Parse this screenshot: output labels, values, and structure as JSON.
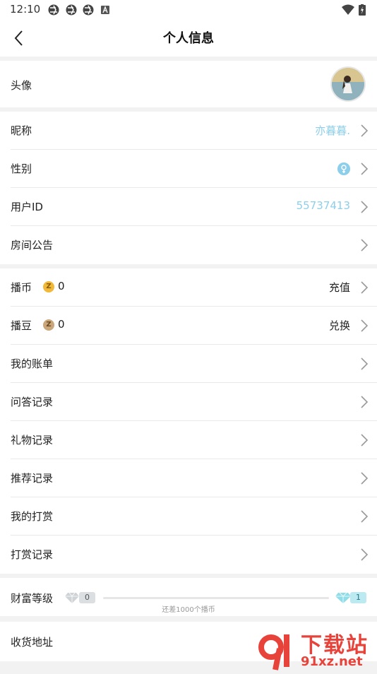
{
  "status_bar": {
    "time": "12:10",
    "icons": [
      "aperture-icon",
      "aperture-icon",
      "aperture-icon",
      "a-box-icon",
      "wifi-icon",
      "battery-charging-icon"
    ]
  },
  "header": {
    "title": "个人信息",
    "back_icon": "chevron-left-icon"
  },
  "profile": {
    "avatar_label": "头像",
    "nickname_label": "昵称",
    "nickname_value": "亦暮暮.",
    "gender_label": "性别",
    "gender_icon": "female-icon",
    "user_id_label": "用户ID",
    "user_id_value": "55737413",
    "room_notice_label": "房间公告"
  },
  "wallet": {
    "coin_label": "播币",
    "coin_badge": "Z",
    "coin_value": "0",
    "coin_action": "充值",
    "bean_label": "播豆",
    "bean_badge": "Z",
    "bean_value": "0",
    "bean_action": "兑换"
  },
  "records": {
    "bill": "我的账单",
    "qa": "问答记录",
    "gift": "礼物记录",
    "recommend": "推荐记录",
    "my_reward": "我的打赏",
    "reward_record": "打赏记录"
  },
  "wealth": {
    "label": "财富等级",
    "current_level": "0",
    "next_level": "1",
    "progress": 0,
    "hint": "还差1000个播币"
  },
  "address": {
    "label": "收货地址"
  },
  "watermark": {
    "brand_text": "下载站",
    "domain_text": "91xz.net"
  },
  "colors": {
    "accent": "#8dcfea",
    "coin": "#f0b93a",
    "bean": "#c9a77b",
    "watermark_red": "#e8433a"
  }
}
